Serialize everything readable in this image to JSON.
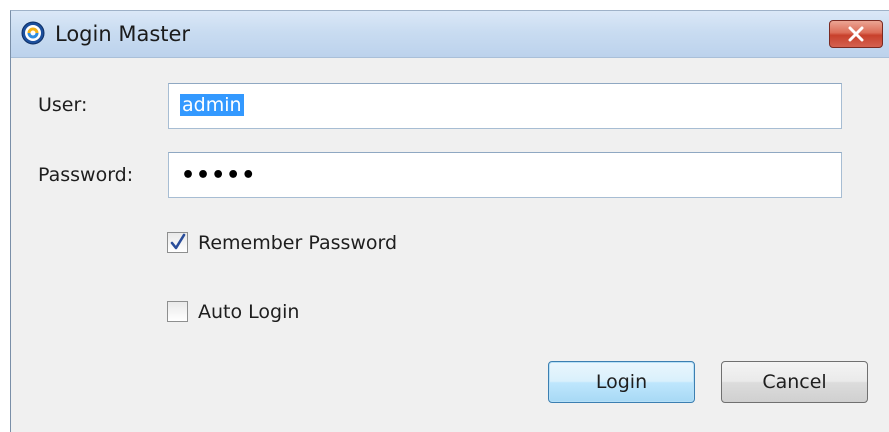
{
  "window": {
    "title": "Login Master",
    "close_label": "×"
  },
  "form": {
    "user_label": "User:",
    "user_value": "admin",
    "password_label": "Password:",
    "password_mask": "•••••",
    "remember_label": "Remember Password",
    "remember_checked": true,
    "auto_login_label": "Auto Login",
    "auto_login_checked": false
  },
  "buttons": {
    "login_label": "Login",
    "cancel_label": "Cancel"
  }
}
